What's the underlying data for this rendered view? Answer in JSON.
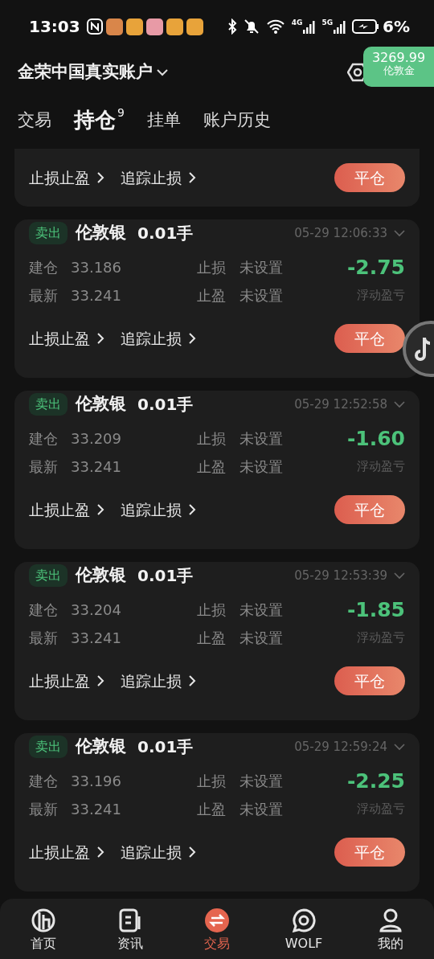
{
  "status_bar": {
    "time": "13:03",
    "notification_icons": [
      {
        "color": "#d9864a"
      },
      {
        "color": "#e8a33a"
      },
      {
        "color": "#e89aa6"
      },
      {
        "color": "#e8a33a"
      },
      {
        "color": "#e8a33a"
      }
    ],
    "networks": [
      {
        "label": "4G"
      },
      {
        "label": "5G"
      }
    ],
    "battery": "6%"
  },
  "header": {
    "account": "金荣中国真实账户"
  },
  "floating_quote": {
    "price": "3269.99",
    "symbol": "伦敦金"
  },
  "tabs": [
    {
      "label": "交易",
      "selected": false
    },
    {
      "label": "持仓",
      "selected": true,
      "count": "9"
    },
    {
      "label": "挂单",
      "selected": false
    },
    {
      "label": "账户历史",
      "selected": false
    }
  ],
  "partial_card": {
    "actions": [
      "止损止盈",
      "追踪止损"
    ],
    "close_button": "平仓"
  },
  "positions": [
    {
      "side": "卖出",
      "symbol": "伦敦银",
      "lots": "0.01手",
      "time": "05-29 12:06:33",
      "open_label": "建仓",
      "open_price": "33.186",
      "latest_label": "最新",
      "latest_price": "33.241",
      "sl_label": "止损",
      "sl_value": "未设置",
      "tp_label": "止盈",
      "tp_value": "未设置",
      "pnl": "-2.75",
      "pnl_label": "浮动盈亏",
      "actions": [
        "止损止盈",
        "追踪止损"
      ],
      "close_button": "平仓"
    },
    {
      "side": "卖出",
      "symbol": "伦敦银",
      "lots": "0.01手",
      "time": "05-29 12:52:58",
      "open_label": "建仓",
      "open_price": "33.209",
      "latest_label": "最新",
      "latest_price": "33.241",
      "sl_label": "止损",
      "sl_value": "未设置",
      "tp_label": "止盈",
      "tp_value": "未设置",
      "pnl": "-1.60",
      "pnl_label": "浮动盈亏",
      "actions": [
        "止损止盈",
        "追踪止损"
      ],
      "close_button": "平仓"
    },
    {
      "side": "卖出",
      "symbol": "伦敦银",
      "lots": "0.01手",
      "time": "05-29 12:53:39",
      "open_label": "建仓",
      "open_price": "33.204",
      "latest_label": "最新",
      "latest_price": "33.241",
      "sl_label": "止损",
      "sl_value": "未设置",
      "tp_label": "止盈",
      "tp_value": "未设置",
      "pnl": "-1.85",
      "pnl_label": "浮动盈亏",
      "actions": [
        "止损止盈",
        "追踪止损"
      ],
      "close_button": "平仓"
    },
    {
      "side": "卖出",
      "symbol": "伦敦银",
      "lots": "0.01手",
      "time": "05-29 12:59:24",
      "open_label": "建仓",
      "open_price": "33.196",
      "latest_label": "最新",
      "latest_price": "33.241",
      "sl_label": "止损",
      "sl_value": "未设置",
      "tp_label": "止盈",
      "tp_value": "未设置",
      "pnl": "-2.25",
      "pnl_label": "浮动盈亏",
      "actions": [
        "止损止盈",
        "追踪止损"
      ],
      "close_button": "平仓"
    }
  ],
  "bottom_nav": [
    {
      "label": "首页",
      "kind": "home",
      "selected": false
    },
    {
      "label": "资讯",
      "kind": "news",
      "selected": false
    },
    {
      "label": "交易",
      "kind": "trade",
      "selected": true
    },
    {
      "label": "WOLF",
      "kind": "wolf",
      "selected": false
    },
    {
      "label": "我的",
      "kind": "profile",
      "selected": false
    }
  ]
}
